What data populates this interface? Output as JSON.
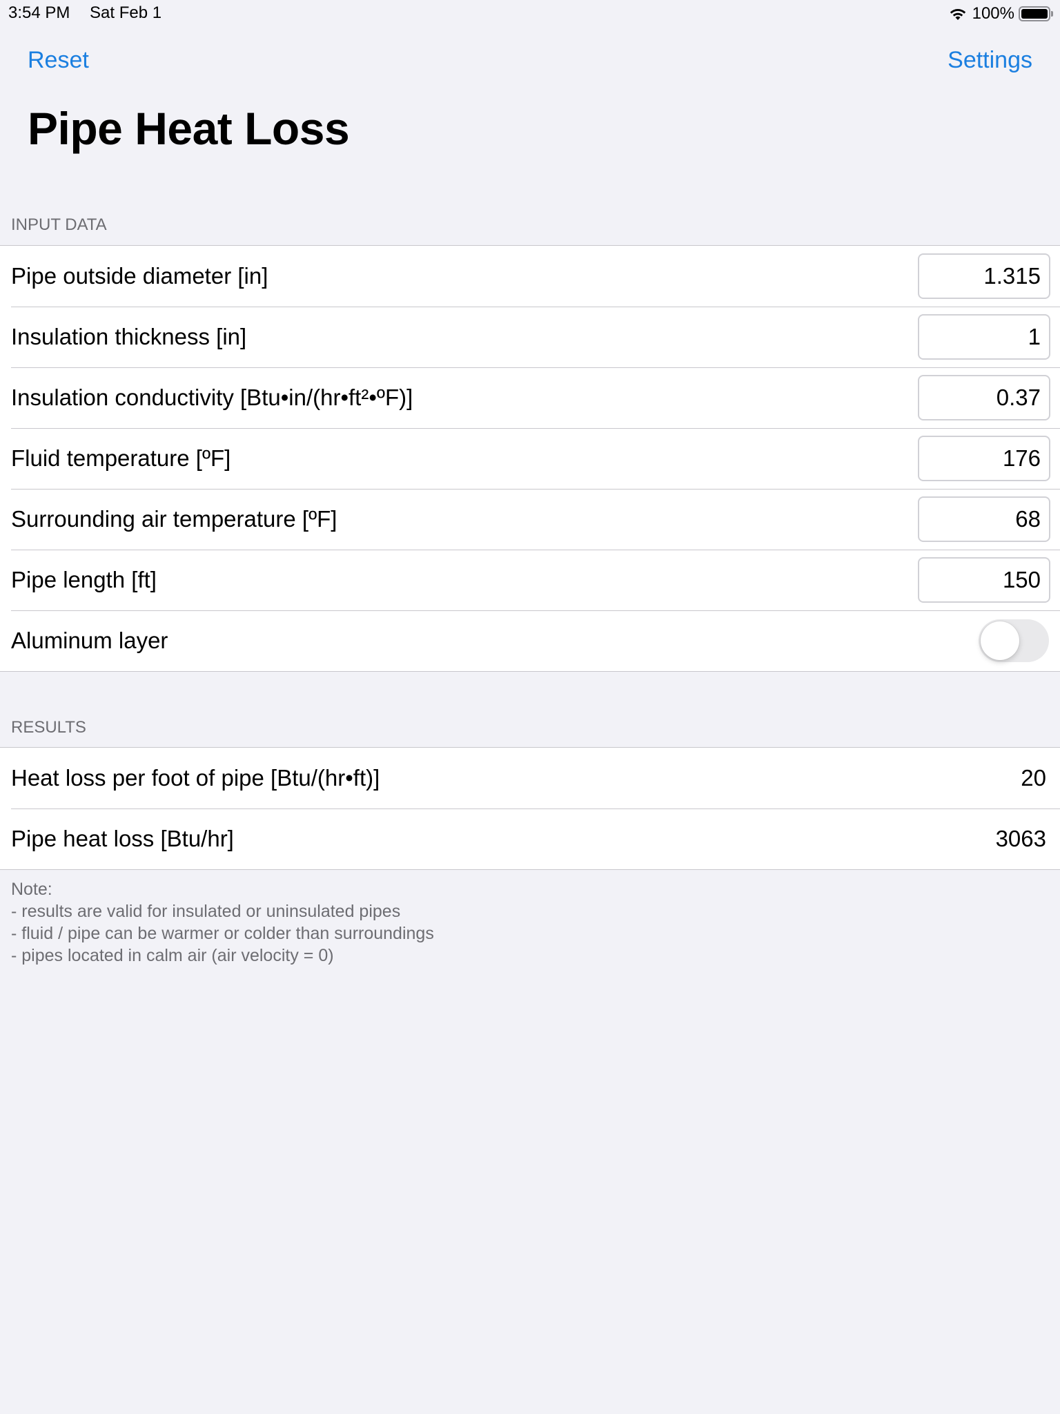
{
  "status_bar": {
    "time": "3:54 PM",
    "date": "Sat Feb 1",
    "wifi_icon": "wifi-icon",
    "battery_percent": "100%",
    "battery_icon": "battery-full-icon",
    "battery_level": 1.0
  },
  "nav": {
    "reset_label": "Reset",
    "settings_label": "Settings"
  },
  "title": "Pipe Heat Loss",
  "input_section": {
    "header": "INPUT DATA",
    "rows": [
      {
        "label": "Pipe outside diameter [in]",
        "value": "1.315"
      },
      {
        "label": "Insulation thickness [in]",
        "value": "1"
      },
      {
        "label": "Insulation conductivity [Btu•in/(hr•ft²•ºF)]",
        "value": "0.37"
      },
      {
        "label": "Fluid temperature [ºF]",
        "value": "176"
      },
      {
        "label": "Surrounding air temperature [ºF]",
        "value": "68"
      },
      {
        "label": "Pipe length [ft]",
        "value": "150"
      }
    ],
    "toggle": {
      "label": "Aluminum layer",
      "on": false
    }
  },
  "results_section": {
    "header": "RESULTS",
    "rows": [
      {
        "label": "Heat loss per foot of pipe [Btu/(hr•ft)]",
        "value": "20"
      },
      {
        "label": "Pipe heat loss [Btu/hr]",
        "value": "3063"
      }
    ]
  },
  "note": {
    "title": "Note:",
    "lines": [
      "- results are valid for insulated or uninsulated pipes",
      "- fluid / pipe can be warmer or colder than surroundings",
      "- pipes located in calm air (air velocity = 0)"
    ]
  },
  "colors": {
    "accent": "#1b7fe0",
    "background": "#f2f2f7",
    "section_header": "#6d6d72"
  }
}
